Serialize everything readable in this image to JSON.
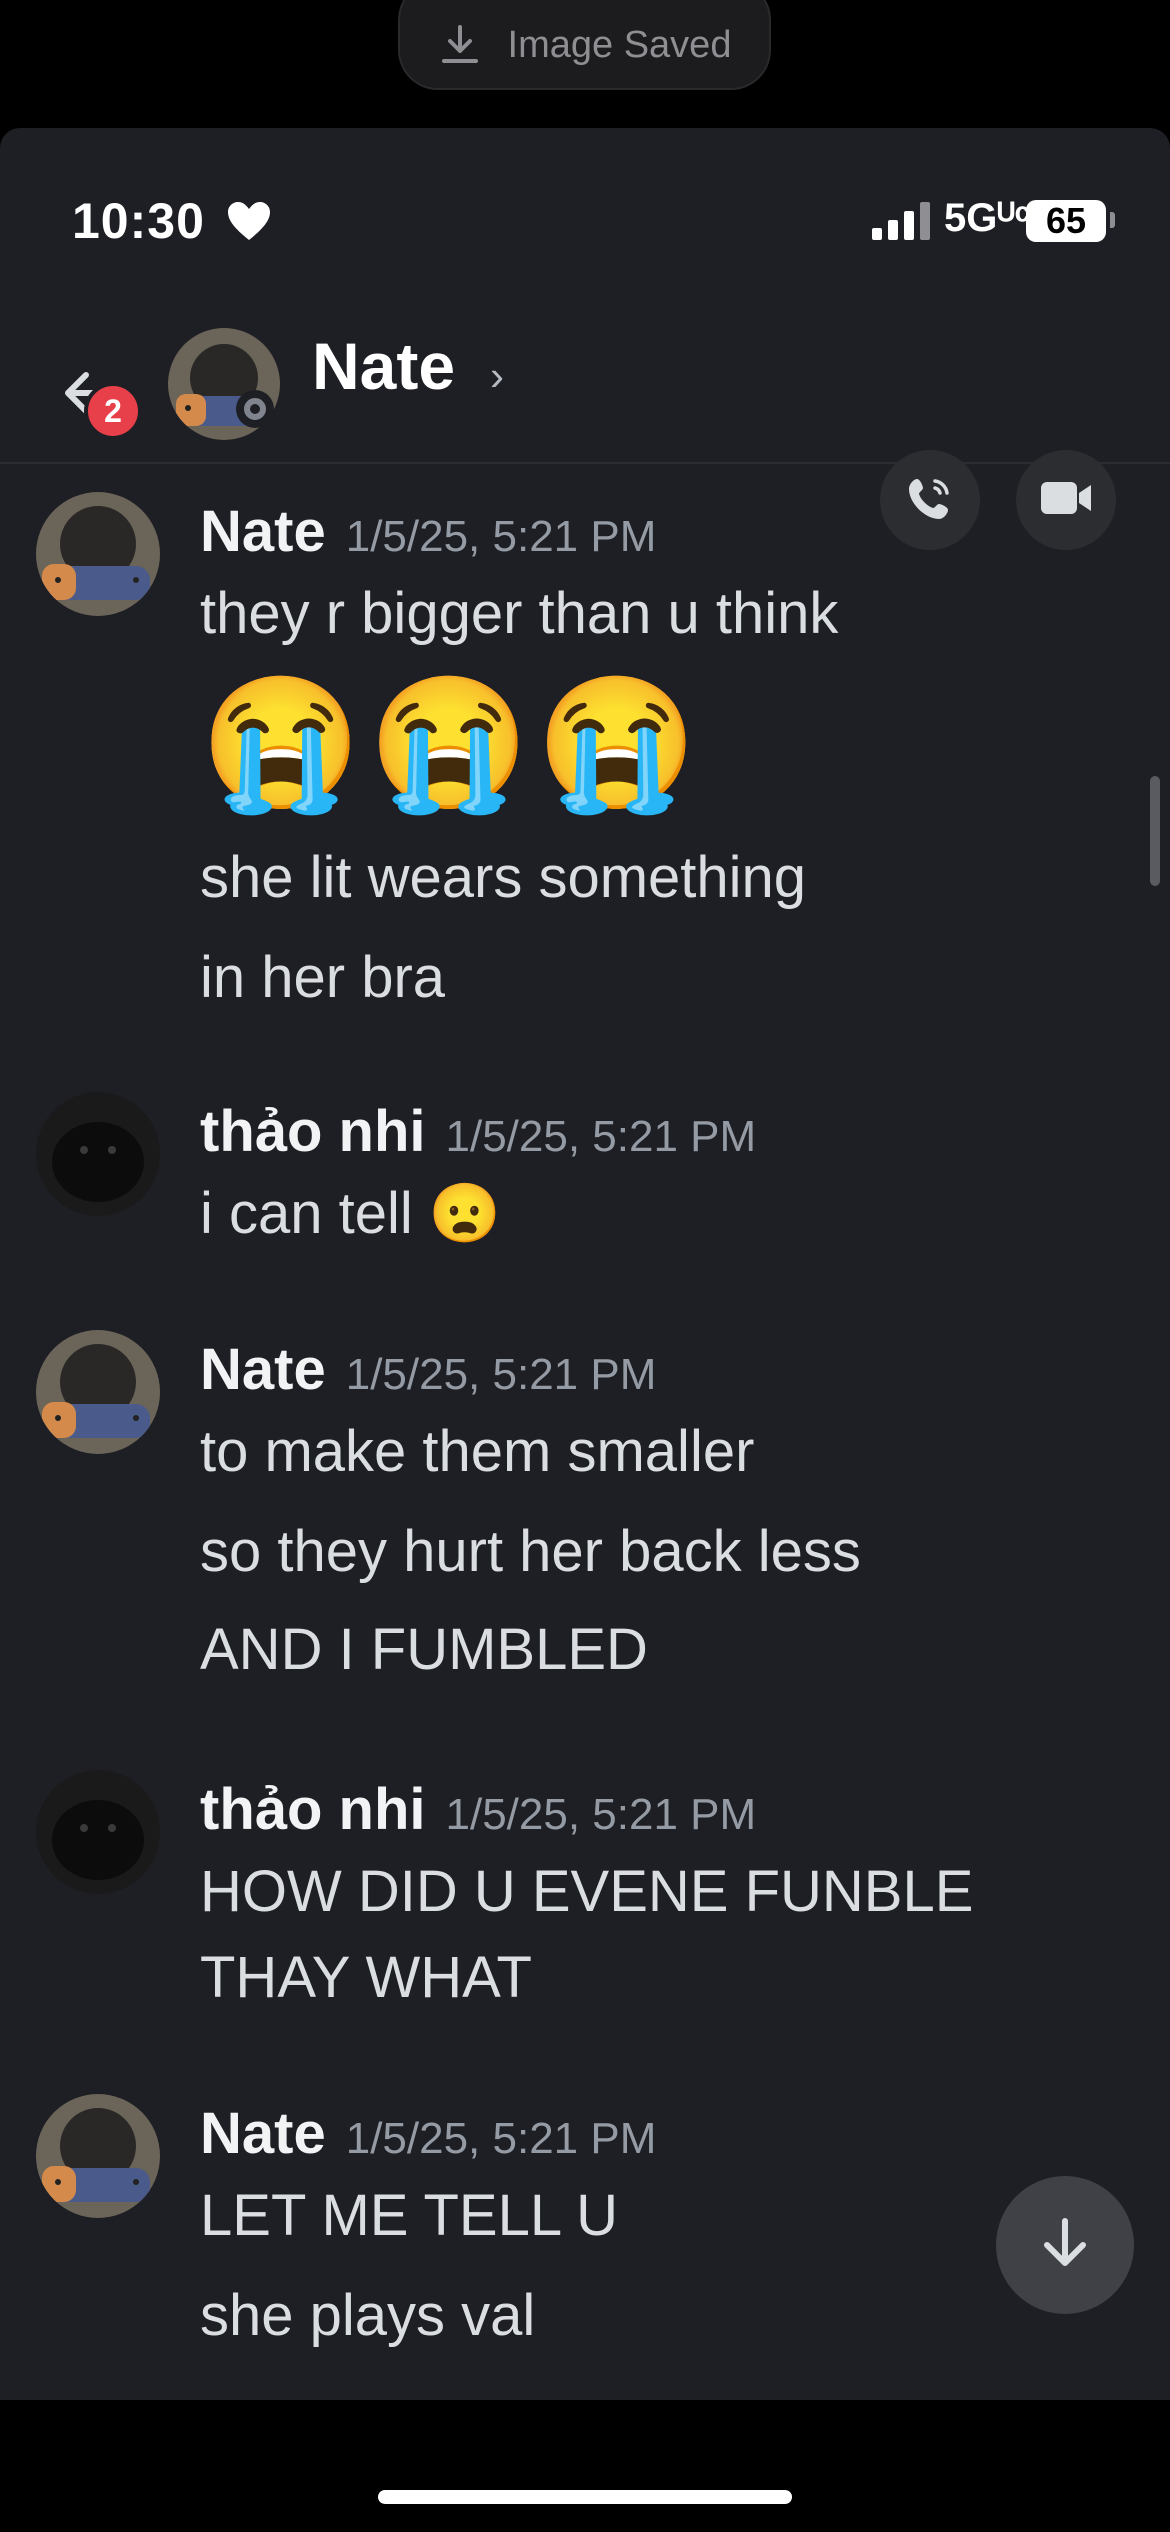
{
  "toast": {
    "label": "Image Saved",
    "icon": "download-icon"
  },
  "status_bar": {
    "time": "10:30",
    "network": "5Gᵁᶜ",
    "battery": "65"
  },
  "header": {
    "unread_badge": "2",
    "title": "Nate",
    "chevron": "›",
    "call_icon": "phone-icon",
    "video_icon": "video-icon"
  },
  "messages": [
    {
      "author": "Nate",
      "timestamp": "1/5/25, 5:21 PM",
      "lines": [
        "they r bigger than u think",
        "😭😭😭",
        "she lit wears something",
        "in her bra"
      ]
    },
    {
      "author": "thảo nhi",
      "timestamp": "1/5/25, 5:21 PM",
      "lines": [
        "i can tell 😦"
      ]
    },
    {
      "author": "Nate",
      "timestamp": "1/5/25, 5:21 PM",
      "lines": [
        "to make them smaller",
        "so they hurt her back less",
        "AND I FUMBLED"
      ]
    },
    {
      "author": "thảo nhi",
      "timestamp": "1/5/25, 5:21 PM",
      "lines": [
        "HOW DID U EVENE FUNBLE",
        "THAY WHAT"
      ]
    },
    {
      "author": "Nate",
      "timestamp": "1/5/25, 5:21 PM",
      "lines": [
        "LET ME TELL U",
        "she plays val"
      ]
    }
  ],
  "colors": {
    "background": "#1e1f24",
    "badge": "#e8404a",
    "timestamp": "#949ba4"
  }
}
